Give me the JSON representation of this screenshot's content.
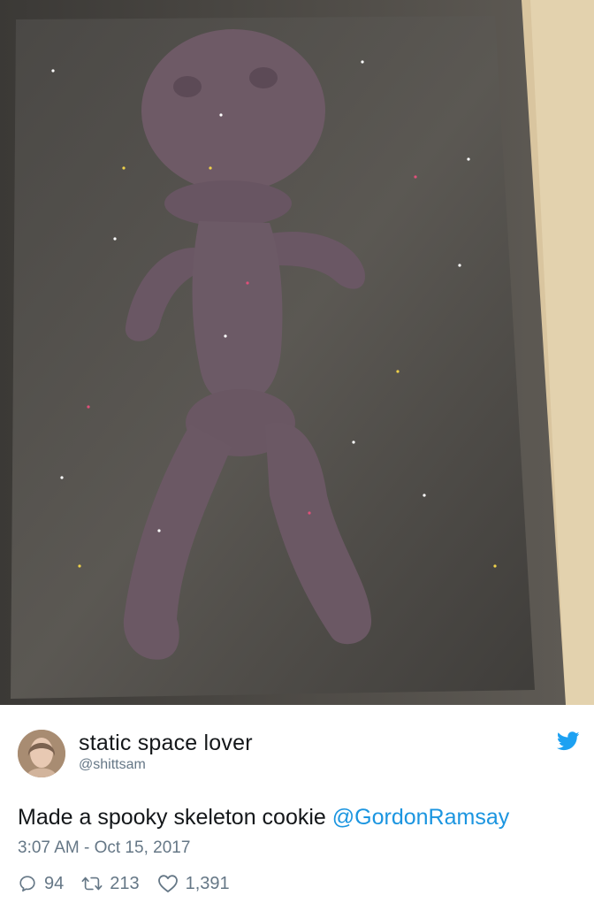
{
  "tweet": {
    "user_name": "static space lover",
    "user_handle": "@shittsam",
    "text": "Made a spooky skeleton cookie ",
    "mention": "@GordonRamsay",
    "timestamp": "3:07 AM - Oct 15, 2017",
    "replies": "94",
    "retweets": "213",
    "likes": "1,391"
  },
  "icons": {
    "logo": "twitter-bird-icon",
    "reply": "reply-bubble-icon",
    "retweet": "retweet-icon",
    "like": "heart-icon"
  },
  "colors": {
    "brand": "#1da1f2",
    "link": "#1b95e0",
    "text": "#14171a",
    "muted": "#657786"
  }
}
